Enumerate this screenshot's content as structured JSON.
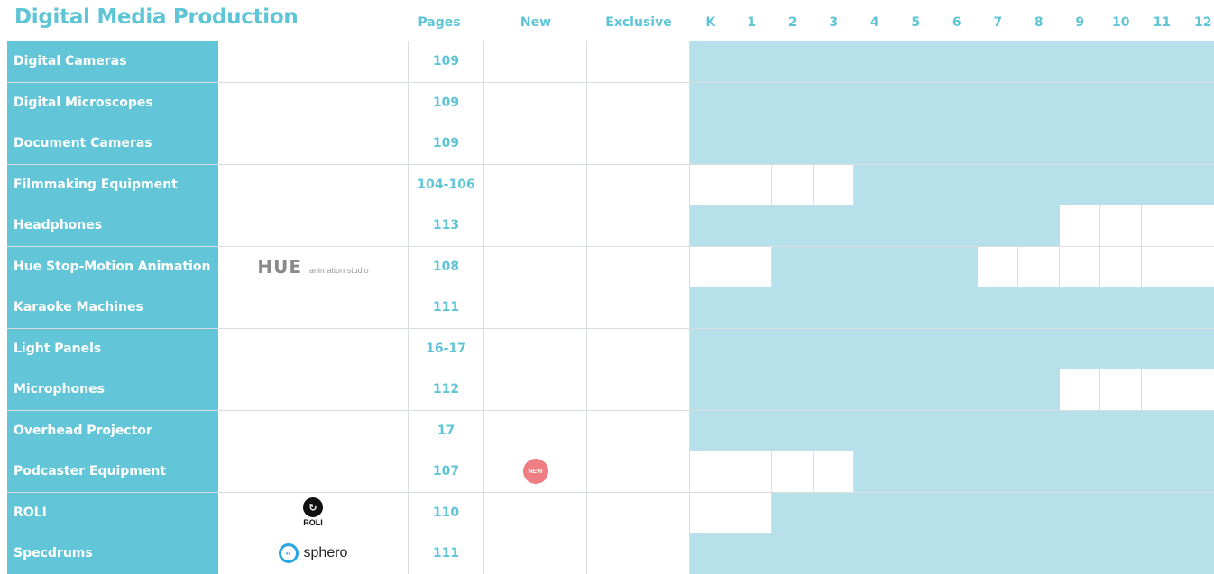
{
  "title": "Digital Media Production",
  "headers": {
    "pages": "Pages",
    "new": "New",
    "exclusive": "Exclusive",
    "grades": [
      "K",
      "1",
      "2",
      "3",
      "4",
      "5",
      "6",
      "7",
      "8",
      "9",
      "10",
      "11",
      "12"
    ]
  },
  "colors": {
    "accent": "#5ec5d7",
    "category_bg": "#63c6d8",
    "grade_fill": "#b6e1ea",
    "new_badge": "#ef7e82"
  },
  "rows": [
    {
      "category": "Digital Cameras",
      "logo": null,
      "pages": "109",
      "new": false,
      "grades": [
        1,
        1,
        1,
        1,
        1,
        1,
        1,
        1,
        1,
        1,
        1,
        1,
        1
      ]
    },
    {
      "category": "Digital Microscopes",
      "logo": null,
      "pages": "109",
      "new": false,
      "grades": [
        1,
        1,
        1,
        1,
        1,
        1,
        1,
        1,
        1,
        1,
        1,
        1,
        1
      ]
    },
    {
      "category": "Document Cameras",
      "logo": null,
      "pages": "109",
      "new": false,
      "grades": [
        1,
        1,
        1,
        1,
        1,
        1,
        1,
        1,
        1,
        1,
        1,
        1,
        1
      ]
    },
    {
      "category": "Filmmaking Equipment",
      "logo": null,
      "pages": "104-106",
      "new": false,
      "grades": [
        0,
        0,
        0,
        0,
        1,
        1,
        1,
        1,
        1,
        1,
        1,
        1,
        1
      ]
    },
    {
      "category": "Headphones",
      "logo": null,
      "pages": "113",
      "new": false,
      "grades": [
        1,
        1,
        1,
        1,
        1,
        1,
        1,
        1,
        1,
        0,
        0,
        0,
        0
      ]
    },
    {
      "category": "Hue Stop-Motion Animation",
      "logo": "hue",
      "logo_text": "HUE",
      "logo_subtext": "animation studio",
      "pages": "108",
      "new": false,
      "grades": [
        0,
        0,
        1,
        1,
        1,
        1,
        1,
        0,
        0,
        0,
        0,
        0,
        0
      ]
    },
    {
      "category": "Karaoke Machines",
      "logo": null,
      "pages": "111",
      "new": false,
      "grades": [
        1,
        1,
        1,
        1,
        1,
        1,
        1,
        1,
        1,
        1,
        1,
        1,
        1
      ]
    },
    {
      "category": "Light Panels",
      "logo": null,
      "pages": "16-17",
      "new": false,
      "grades": [
        1,
        1,
        1,
        1,
        1,
        1,
        1,
        1,
        1,
        1,
        1,
        1,
        1
      ]
    },
    {
      "category": "Microphones",
      "logo": null,
      "pages": "112",
      "new": false,
      "grades": [
        1,
        1,
        1,
        1,
        1,
        1,
        1,
        1,
        1,
        0,
        0,
        0,
        0
      ]
    },
    {
      "category": "Overhead Projector",
      "logo": null,
      "pages": "17",
      "new": false,
      "grades": [
        1,
        1,
        1,
        1,
        1,
        1,
        1,
        1,
        1,
        1,
        1,
        1,
        1
      ]
    },
    {
      "category": "Podcaster Equipment",
      "logo": null,
      "pages": "107",
      "new": true,
      "new_label": "NEW",
      "grades": [
        0,
        0,
        0,
        0,
        1,
        1,
        1,
        1,
        1,
        1,
        1,
        1,
        1
      ]
    },
    {
      "category": "ROLI",
      "logo": "roli",
      "logo_text": "ROLI",
      "pages": "110",
      "new": false,
      "grades": [
        0,
        0,
        1,
        1,
        1,
        1,
        1,
        1,
        1,
        1,
        1,
        1,
        1
      ]
    },
    {
      "category": "Specdrums",
      "logo": "sphero",
      "logo_text": "sphero",
      "pages": "111",
      "new": false,
      "grades": [
        1,
        1,
        1,
        1,
        1,
        1,
        1,
        1,
        1,
        1,
        1,
        1,
        1
      ]
    }
  ]
}
